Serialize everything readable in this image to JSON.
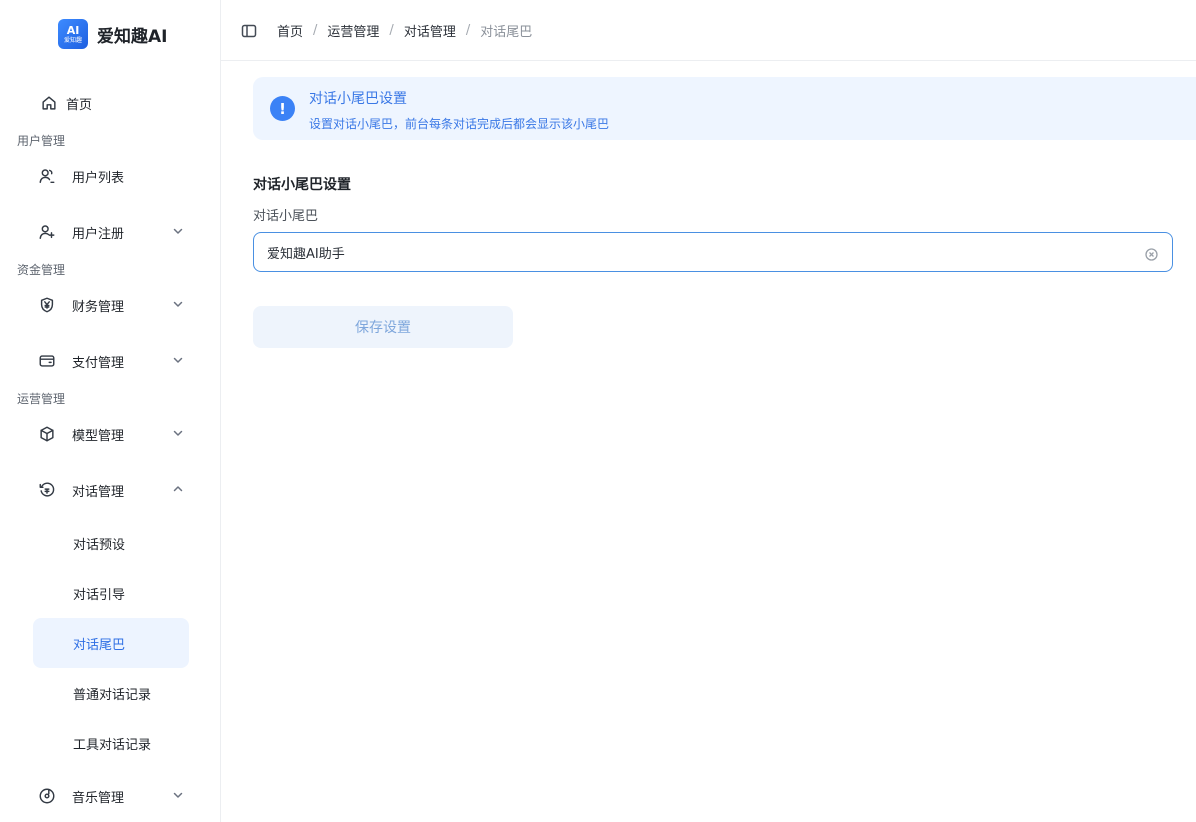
{
  "logo": {
    "badge_main": "AI",
    "badge_sub": "爱知趣",
    "title": "爱知趣AI"
  },
  "sidebar": {
    "home": "首页",
    "groups": {
      "users": "用户管理",
      "funds": "资金管理",
      "operations": "运营管理"
    },
    "items": {
      "user_list": "用户列表",
      "user_register": "用户注册",
      "finance": "财务管理",
      "payment": "支付管理",
      "model": "模型管理",
      "dialog": "对话管理",
      "music": "音乐管理"
    },
    "dialog_children": {
      "preset": "对话预设",
      "guide": "对话引导",
      "tail": "对话尾巴",
      "normal_records": "普通对话记录",
      "tool_records": "工具对话记录"
    }
  },
  "breadcrumb": [
    "首页",
    "运营管理",
    "对话管理",
    "对话尾巴"
  ],
  "alert": {
    "title": "对话小尾巴设置",
    "description": "设置对话小尾巴，前台每条对话完成后都会显示该小尾巴"
  },
  "form": {
    "section_title": "对话小尾巴设置",
    "field_label": "对话小尾巴",
    "field_value": "爱知趣AI助手",
    "save_label": "保存设置"
  },
  "colors": {
    "accent": "#3b82f6",
    "active_bg": "#edf4ff",
    "alert_bg": "#eef5ff"
  }
}
